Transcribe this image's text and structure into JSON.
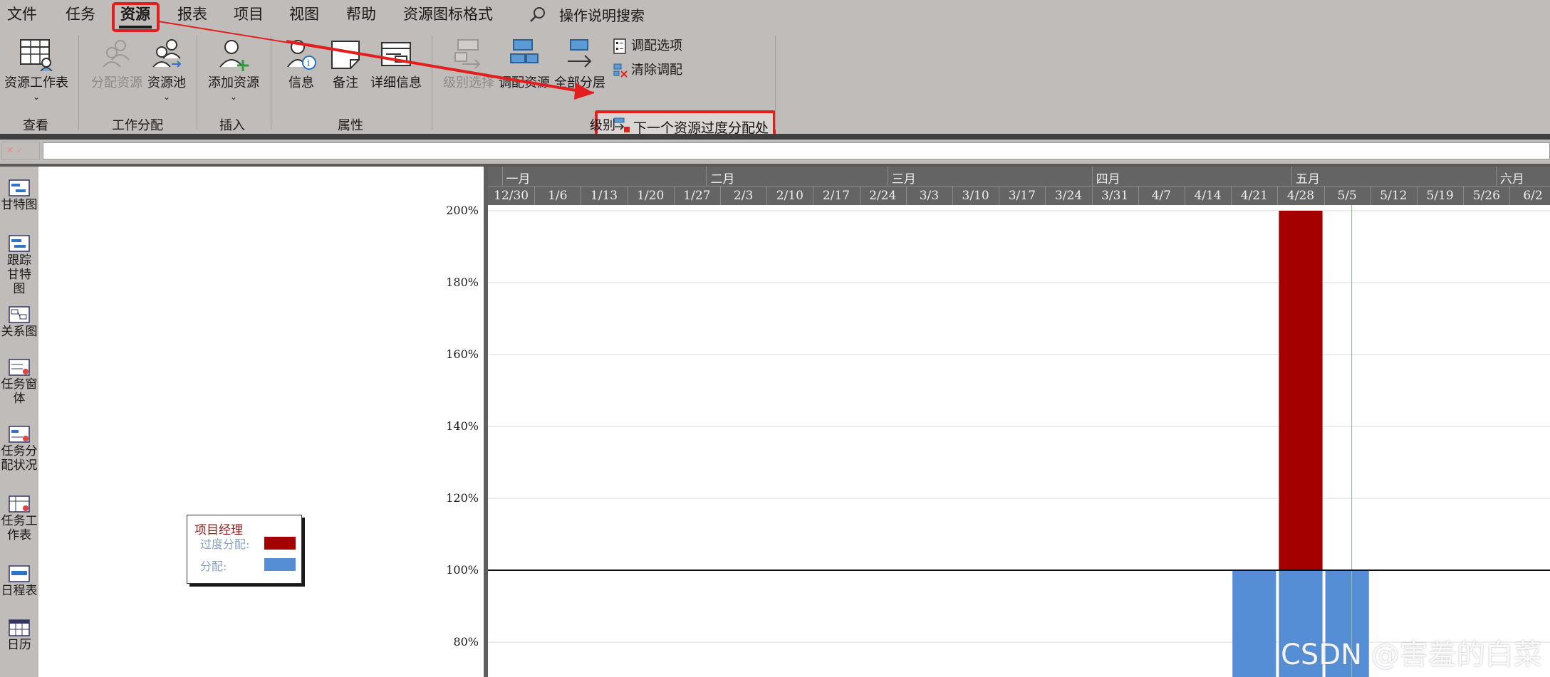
{
  "menu": {
    "items": [
      {
        "label": "文件"
      },
      {
        "label": "任务"
      },
      {
        "label": "资源"
      },
      {
        "label": "报表"
      },
      {
        "label": "项目"
      },
      {
        "label": "视图"
      },
      {
        "label": "帮助"
      },
      {
        "label": "资源图标格式"
      }
    ],
    "active": "资源",
    "search_label": "操作说明搜索"
  },
  "ribbon": {
    "groups": {
      "view": "查看",
      "assign": "工作分配",
      "insert": "插入",
      "properties": "属性",
      "level": "级别"
    },
    "buttons": {
      "resource_sheet": "资源工作表",
      "assign_resources": "分配资源",
      "resource_pool": "资源池",
      "add_resource": "添加资源",
      "information": "信息",
      "notes": "备注",
      "details": "详细信息",
      "level_selection": "级别选择",
      "level_resource": "调配资源",
      "level_all": "全部分层",
      "leveling_options": "调配选项",
      "clear_leveling": "清除调配",
      "next_overallocation": "下一个资源过度分配处"
    }
  },
  "views": [
    {
      "label": "甘特图"
    },
    {
      "label": "跟踪甘特图"
    },
    {
      "label": "关系图"
    },
    {
      "label": "任务窗体"
    },
    {
      "label": "任务分配状况"
    },
    {
      "label": "任务工作表"
    },
    {
      "label": "日程表"
    },
    {
      "label": "日历"
    }
  ],
  "legend": {
    "title": "项目经理",
    "overallocated_label": "过度分配:",
    "allocated_label": "分配:",
    "overallocated_color": "#a40000",
    "allocated_color": "#558ed5"
  },
  "timescale": {
    "months": [
      "一月",
      "二月",
      "三月",
      "四月",
      "五月",
      "六月"
    ],
    "weeks": [
      "12/30",
      "1/6",
      "1/13",
      "1/20",
      "1/27",
      "2/3",
      "2/10",
      "2/17",
      "2/24",
      "3/3",
      "3/10",
      "3/17",
      "3/24",
      "3/31",
      "4/7",
      "4/14",
      "4/21",
      "4/28",
      "5/5",
      "5/12",
      "5/19",
      "5/26",
      "6/2"
    ]
  },
  "chart_data": {
    "type": "bar",
    "title": "",
    "ylabel": "",
    "xlabel": "",
    "y_ticks": [
      "200%",
      "180%",
      "160%",
      "140%",
      "120%",
      "100%",
      "80%"
    ],
    "categories": [
      "4/21",
      "4/28",
      "5/5"
    ],
    "series": [
      {
        "name": "分配:",
        "values": [
          100,
          100,
          100
        ]
      },
      {
        "name": "过度分配:",
        "values": [
          0,
          100,
          0
        ]
      }
    ],
    "ylim": [
      80,
      200
    ],
    "reference_line": 100,
    "grid": true
  },
  "watermark": "CSDN @害羞的白菜"
}
